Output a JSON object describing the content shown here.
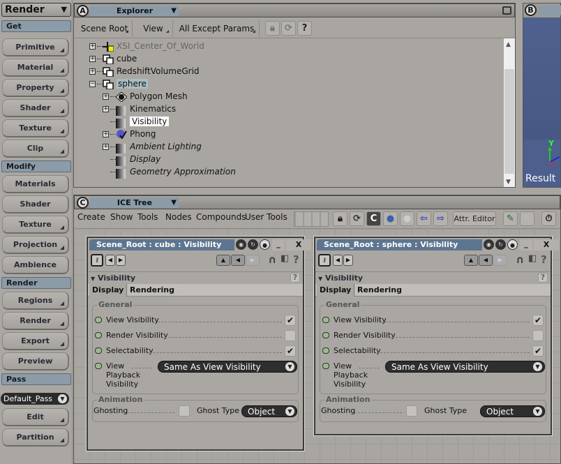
{
  "left_toolbar": {
    "mode": "Render",
    "sections": [
      {
        "label": "Get",
        "buttons": [
          {
            "label": "Primitive",
            "submenu": true
          },
          {
            "label": "Material",
            "submenu": true
          },
          {
            "label": "Property",
            "submenu": true
          },
          {
            "label": "Shader",
            "submenu": true
          },
          {
            "label": "Texture",
            "submenu": true
          },
          {
            "label": "Clip",
            "submenu": true
          }
        ]
      },
      {
        "label": "Modify",
        "buttons": [
          {
            "label": "Materials",
            "submenu": false
          },
          {
            "label": "Shader",
            "submenu": false
          },
          {
            "label": "Texture",
            "submenu": true
          },
          {
            "label": "Projection",
            "submenu": true
          },
          {
            "label": "Ambience",
            "submenu": false
          }
        ]
      },
      {
        "label": "Render",
        "buttons": [
          {
            "label": "Regions",
            "submenu": true
          },
          {
            "label": "Render",
            "submenu": true
          },
          {
            "label": "Export",
            "submenu": true
          },
          {
            "label": "Preview",
            "submenu": false
          }
        ]
      },
      {
        "label": "Pass",
        "buttons": [
          {
            "label": "Edit",
            "submenu": true
          },
          {
            "label": "Partition",
            "submenu": true
          }
        ]
      }
    ],
    "pass_select": "Default_Pass"
  },
  "explorer": {
    "letter": "A",
    "title": "Explorer",
    "toolbar": {
      "scene_root": "Scene Root",
      "view": "View",
      "filter": "All Except Params"
    },
    "tree": [
      {
        "label": "XSI_Center_Of_World",
        "depth": 0,
        "expander": "+",
        "icon": "null-icon",
        "style": "grey"
      },
      {
        "label": "cube",
        "depth": 0,
        "expander": "+",
        "icon": "model-icon",
        "style": "normal"
      },
      {
        "label": "RedshiftVolumeGrid",
        "depth": 0,
        "expander": "+",
        "icon": "model-icon",
        "style": "normal"
      },
      {
        "label": "sphere",
        "depth": 0,
        "expander": "-",
        "icon": "model-icon",
        "style": "selected"
      },
      {
        "label": "Polygon Mesh",
        "depth": 1,
        "expander": "+",
        "icon": "primitive-icon",
        "style": "normal"
      },
      {
        "label": "Kinematics",
        "depth": 1,
        "expander": "+",
        "icon": "property-icon",
        "style": "normal"
      },
      {
        "label": "Visibility",
        "depth": 1,
        "expander": "",
        "icon": "property-icon",
        "style": "highlight"
      },
      {
        "label": "Phong",
        "depth": 1,
        "expander": "+",
        "icon": "material-icon",
        "style": "normal"
      },
      {
        "label": "Ambient Lighting",
        "depth": 1,
        "expander": "+",
        "icon": "property-icon",
        "style": "italic"
      },
      {
        "label": "Display",
        "depth": 1,
        "expander": "",
        "icon": "property-icon",
        "style": "italic"
      },
      {
        "label": "Geometry Approximation",
        "depth": 1,
        "expander": "",
        "icon": "property-icon",
        "style": "italic"
      }
    ]
  },
  "viewport_b": {
    "letter": "B",
    "label": "Result",
    "axis_y": "Y"
  },
  "ice_tree": {
    "letter": "C",
    "title": "ICE Tree",
    "menus": [
      "Create",
      "Show",
      "Tools",
      "Nodes",
      "Compounds",
      "User Tools"
    ],
    "attr_editor": "Attr. Editor"
  },
  "ppg_panels": [
    {
      "title": "Scene_Root : cube : Visibility",
      "section": "Visibility",
      "tabs": [
        "Display",
        "Rendering"
      ],
      "active_tab": "Display",
      "general_label": "General",
      "params": [
        {
          "label": "View Visibility",
          "checked": true
        },
        {
          "label": "Render Visibility",
          "checked": false
        },
        {
          "label": "Selectability",
          "checked": true
        }
      ],
      "playback": {
        "label": "View Playback Visibility",
        "value": "Same As View Visibility"
      },
      "animation_label": "Animation",
      "ghosting": {
        "label": "Ghosting",
        "checked": false
      },
      "ghost_type": {
        "label": "Ghost Type",
        "value": "Object"
      }
    },
    {
      "title": "Scene_Root : sphere : Visibility",
      "section": "Visibility",
      "tabs": [
        "Display",
        "Rendering"
      ],
      "active_tab": "Display",
      "general_label": "General",
      "params": [
        {
          "label": "View Visibility",
          "checked": true
        },
        {
          "label": "Render Visibility",
          "checked": false
        },
        {
          "label": "Selectability",
          "checked": true
        }
      ],
      "playback": {
        "label": "View Playback Visibility",
        "value": "Same As View Visibility"
      },
      "animation_label": "Animation",
      "ghosting": {
        "label": "Ghosting",
        "checked": false
      },
      "ghost_type": {
        "label": "Ghost Type",
        "value": "Object"
      }
    }
  ],
  "glyphs": {
    "check": "✔",
    "dropdown": "▼",
    "close": "X",
    "minimize": "_",
    "help": "?",
    "left": "◀",
    "right": "▶"
  }
}
